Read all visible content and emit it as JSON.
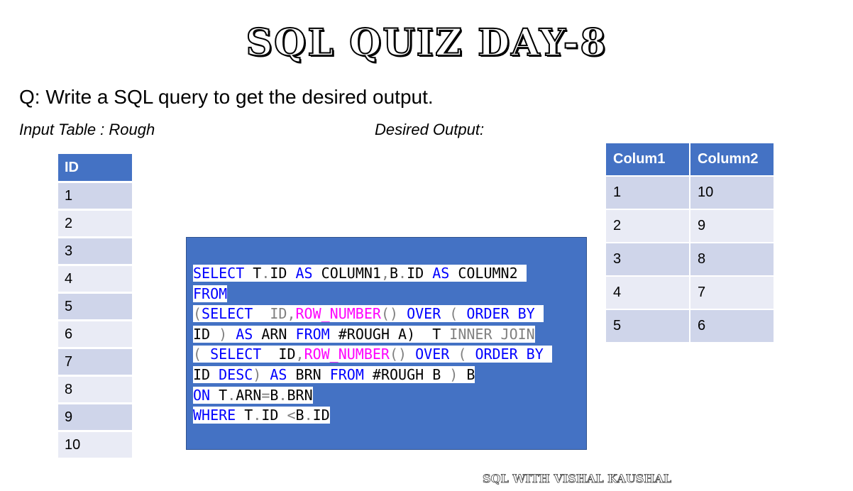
{
  "title": "SQL QUIZ DAY-8",
  "question": "Q: Write a SQL query to get the desired output.",
  "input_caption": "Input Table : Rough",
  "output_caption": "Desired Output:",
  "input_table": {
    "header": "ID",
    "rows": [
      "1",
      "2",
      "3",
      "4",
      "5",
      "6",
      "7",
      "8",
      "9",
      "10"
    ]
  },
  "output_table": {
    "headers": [
      "Colum1",
      "Column2"
    ],
    "rows": [
      [
        "1",
        "10"
      ],
      [
        "2",
        "9"
      ],
      [
        "3",
        "8"
      ],
      [
        "4",
        "7"
      ],
      [
        "5",
        "6"
      ]
    ]
  },
  "code": {
    "lines": [
      [
        [
          "kw",
          "SELECT"
        ],
        [
          "tx",
          " T"
        ],
        [
          "gr",
          "."
        ],
        [
          "tx",
          "ID "
        ],
        [
          "kw",
          "AS"
        ],
        [
          "tx",
          " COLUMN1"
        ],
        [
          "gr",
          ","
        ],
        [
          "tx",
          "B"
        ],
        [
          "gr",
          "."
        ],
        [
          "tx",
          "ID "
        ],
        [
          "kw",
          "AS"
        ],
        [
          "tx",
          " COLUMN2 "
        ]
      ],
      [
        [
          "kw",
          "FROM"
        ]
      ],
      [
        [
          "gr",
          "("
        ],
        [
          "kw",
          "SELECT"
        ],
        [
          "tx",
          "  "
        ],
        [
          "gr",
          "ID,"
        ],
        [
          "fn",
          "ROW_NUMBER"
        ],
        [
          "gr",
          "()"
        ],
        [
          "tx",
          " "
        ],
        [
          "kw",
          "OVER"
        ],
        [
          "tx",
          " "
        ],
        [
          "gr",
          "("
        ],
        [
          "tx",
          " "
        ],
        [
          "kw",
          "ORDER BY"
        ],
        [
          "tx",
          " "
        ]
      ],
      [
        [
          "tx",
          "ID "
        ],
        [
          "gr",
          ")"
        ],
        [
          "tx",
          " "
        ],
        [
          "kw",
          "AS"
        ],
        [
          "tx",
          " ARN "
        ],
        [
          "kw",
          "FROM"
        ],
        [
          "tx",
          " #ROUGH A)  T "
        ],
        [
          "gr",
          "INNER JOIN"
        ]
      ],
      [
        [
          "gr",
          "("
        ],
        [
          "tx",
          " "
        ],
        [
          "kw",
          "SELECT"
        ],
        [
          "tx",
          "  ID"
        ],
        [
          "gr",
          ","
        ],
        [
          "fn",
          "ROW_NUMBER"
        ],
        [
          "gr",
          "()"
        ],
        [
          "tx",
          " "
        ],
        [
          "kw",
          "OVER"
        ],
        [
          "tx",
          " "
        ],
        [
          "gr",
          "("
        ],
        [
          "tx",
          " "
        ],
        [
          "kw",
          "ORDER BY"
        ],
        [
          "tx",
          " "
        ]
      ],
      [
        [
          "tx",
          "ID "
        ],
        [
          "kw",
          "DESC"
        ],
        [
          "gr",
          ")"
        ],
        [
          "tx",
          " "
        ],
        [
          "kw",
          "AS"
        ],
        [
          "tx",
          " BRN "
        ],
        [
          "kw",
          "FROM"
        ],
        [
          "tx",
          " #ROUGH B "
        ],
        [
          "gr",
          ")"
        ],
        [
          "tx",
          " B"
        ]
      ],
      [
        [
          "kw",
          "ON"
        ],
        [
          "tx",
          " T"
        ],
        [
          "gr",
          "."
        ],
        [
          "tx",
          "ARN"
        ],
        [
          "gr",
          "="
        ],
        [
          "tx",
          "B"
        ],
        [
          "gr",
          "."
        ],
        [
          "tx",
          "BRN"
        ]
      ],
      [
        [
          "kw",
          "WHERE"
        ],
        [
          "tx",
          " T"
        ],
        [
          "gr",
          "."
        ],
        [
          "tx",
          "ID "
        ],
        [
          "gr",
          "<"
        ],
        [
          "tx",
          "B"
        ],
        [
          "gr",
          "."
        ],
        [
          "tx",
          "ID"
        ]
      ]
    ]
  },
  "footer": "SQL WITH VISHAL KAUSHAL",
  "colors": {
    "header_blue": "#4472c4",
    "row_dark": "#cfd5ea",
    "row_light": "#e9ebf5",
    "keyword": "#0000ff",
    "function": "#ff00ff",
    "operator": "#808080"
  }
}
